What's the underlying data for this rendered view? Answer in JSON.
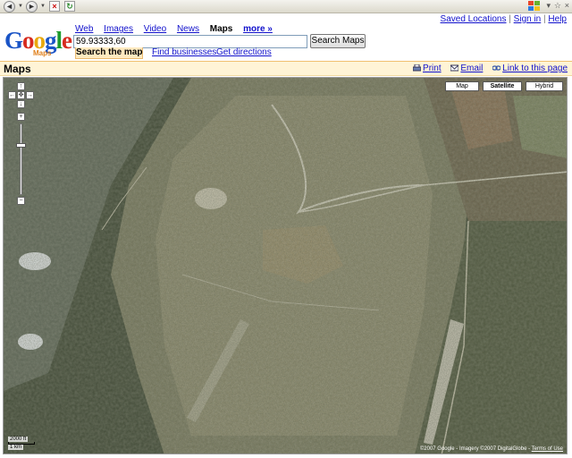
{
  "top_links": {
    "saved_locations": "Saved Locations",
    "sign_in": "Sign in",
    "help": "Help",
    "separator": "|"
  },
  "logo": {
    "letters": [
      "G",
      "o",
      "o",
      "g",
      "l",
      "e"
    ],
    "colors": [
      "#1a54c6",
      "#d62b1f",
      "#e9a90e",
      "#1a54c6",
      "#1d9a2e",
      "#d62b1f"
    ],
    "sub": "Maps"
  },
  "nav": {
    "web": "Web",
    "images": "Images",
    "video": "Video",
    "news": "News",
    "maps": "Maps",
    "more": "more »"
  },
  "search": {
    "value": "59.93333,60",
    "button": "Search Maps",
    "tab_search": "Search the map",
    "tab_business": "Find businesses",
    "tab_directions": "Get directions"
  },
  "maps_bar": {
    "title": "Maps",
    "print": "Print",
    "email": "Email",
    "link": "Link to this page"
  },
  "map_types": {
    "map": "Map",
    "satellite": "Satellite",
    "hybrid": "Hybrid",
    "selected": "Satellite"
  },
  "zoom": {
    "pan_up": "↑",
    "pan_left": "←",
    "pan_center": "✥",
    "pan_right": "→",
    "pan_down": "↓",
    "zoom_in": "+",
    "zoom_out": "−"
  },
  "scale": {
    "ft": "2000 ft",
    "km": "1 km"
  },
  "copyright": {
    "text": "©2007 Google - Imagery ©2007 DigitalGlobe -",
    "terms": "Terms of Use"
  },
  "colors": {
    "link": "#1111cc",
    "maps_bar_bg": "#fff4d6",
    "active_tab_bg": "#ffeac0"
  }
}
